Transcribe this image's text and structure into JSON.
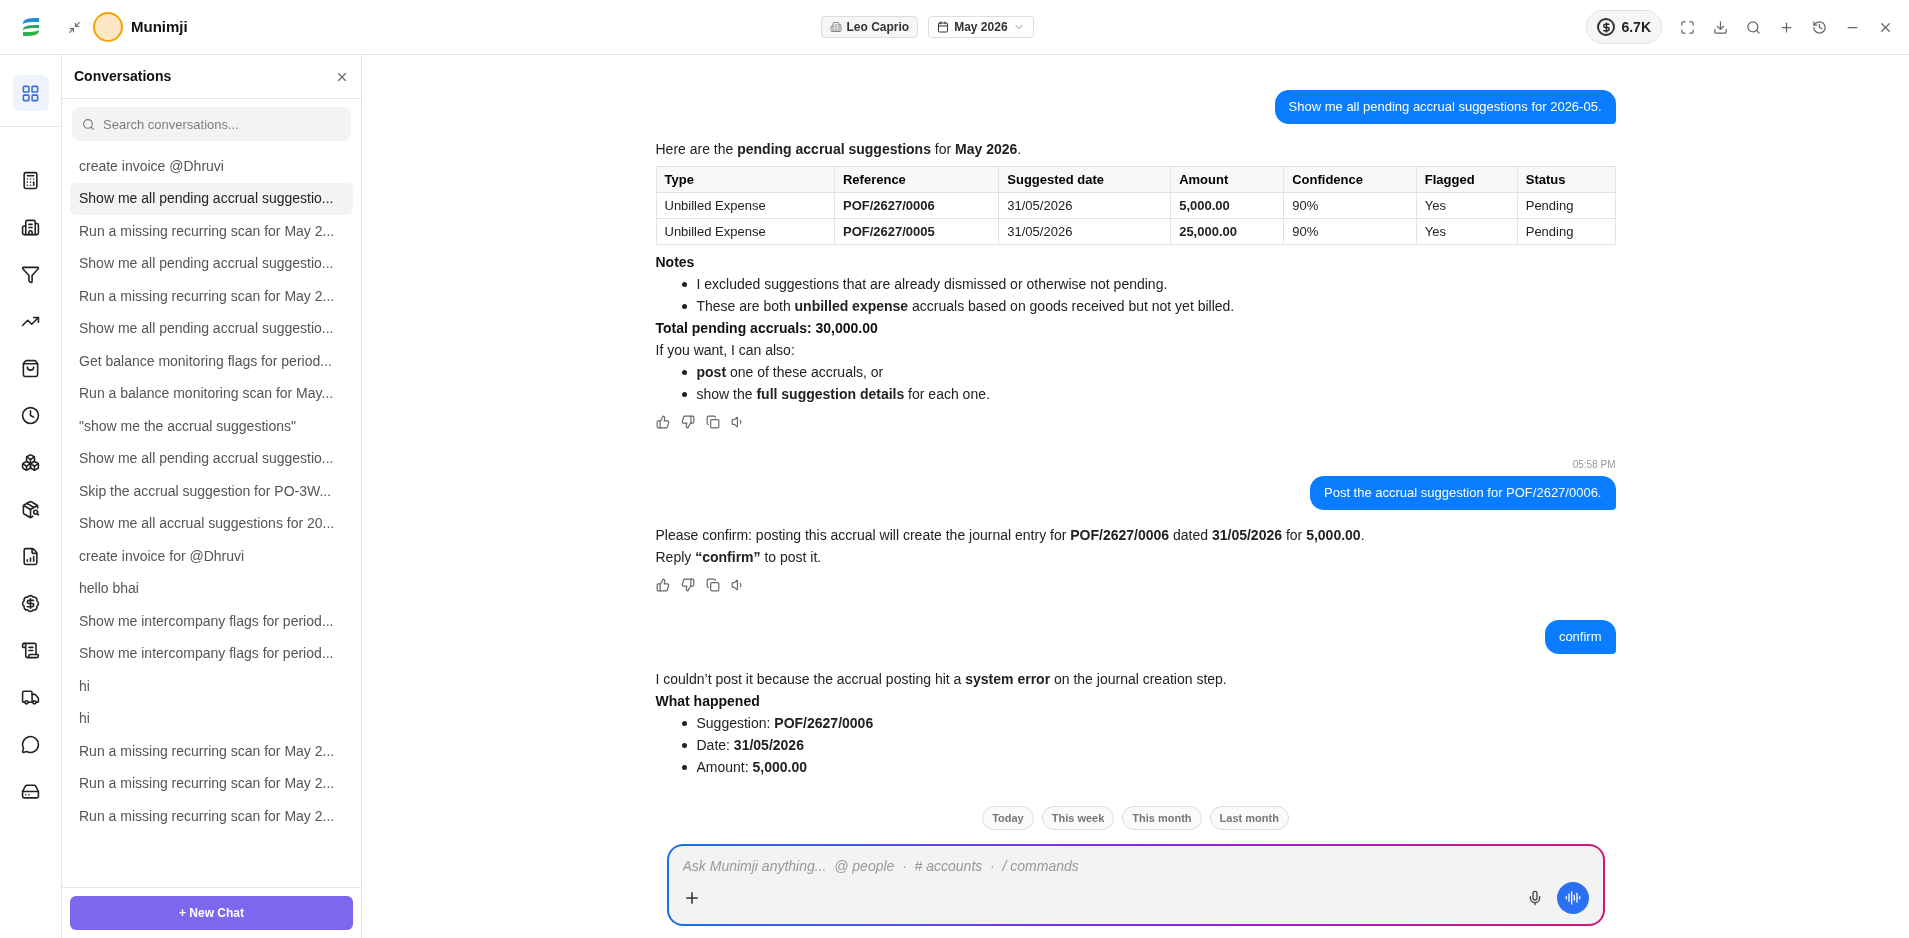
{
  "app": {
    "title": "Munimji"
  },
  "rail": [
    {
      "selected": true
    },
    {
      "selected": false
    },
    {
      "selected": false
    },
    {
      "selected": false
    },
    {
      "selected": false
    },
    {
      "selected": false
    },
    {
      "selected": false
    },
    {
      "selected": false
    },
    {
      "selected": false
    },
    {
      "selected": false
    },
    {
      "selected": false
    },
    {
      "selected": false
    },
    {
      "selected": false
    },
    {
      "selected": false
    },
    {
      "selected": false
    }
  ],
  "header": {
    "company": "Leo Caprio",
    "period": "May 2026",
    "balance": "6.7K"
  },
  "sidebar": {
    "title": "Conversations",
    "search": {
      "placeholder": "Search conversations..."
    },
    "new_chat": "+ New Chat",
    "items": [
      {
        "label": "create invoice @Dhruvi",
        "selected": false
      },
      {
        "label": "Show me all pending accrual suggestio...",
        "selected": true
      },
      {
        "label": "Run a missing recurring scan for May 2...",
        "selected": false
      },
      {
        "label": "Show me all pending accrual suggestio...",
        "selected": false
      },
      {
        "label": "Run a missing recurring scan for May 2...",
        "selected": false
      },
      {
        "label": "Show me all pending accrual suggestio...",
        "selected": false
      },
      {
        "label": "Get balance monitoring flags for period...",
        "selected": false
      },
      {
        "label": "Run a balance monitoring scan for May...",
        "selected": false
      },
      {
        "label": "\"show me the accrual suggestions\"",
        "selected": false
      },
      {
        "label": "Show me all pending accrual suggestio...",
        "selected": false
      },
      {
        "label": "Skip the accrual suggestion for PO-3W...",
        "selected": false
      },
      {
        "label": "Show me all accrual suggestions for 20...",
        "selected": false
      },
      {
        "label": "create invoice for @Dhruvi",
        "selected": false
      },
      {
        "label": "hello bhai",
        "selected": false
      },
      {
        "label": "Show me intercompany flags for period...",
        "selected": false
      },
      {
        "label": "Show me intercompany flags for period...",
        "selected": false
      },
      {
        "label": "hi",
        "selected": false
      },
      {
        "label": "hi",
        "selected": false
      },
      {
        "label": "Run a missing recurring scan for May 2...",
        "selected": false
      },
      {
        "label": "Run a missing recurring scan for May 2...",
        "selected": false
      },
      {
        "label": "Run a missing recurring scan for May 2...",
        "selected": false
      }
    ]
  },
  "messages": [
    {
      "kind": "user",
      "text": "Show me all pending accrual suggestions for 2026-05."
    },
    {
      "kind": "assistant",
      "feedback": true,
      "blocks": [
        {
          "kind": "paragraph",
          "text": "Here are the **pending accrual suggestions** for **May 2026**."
        },
        {
          "kind": "table",
          "columns": [
            "Type",
            "Reference",
            "Suggested date",
            "Amount",
            "Confidence",
            "Flagged",
            "Status"
          ],
          "rows": [
            [
              "Unbilled Expense",
              "**POF/2627/0006**",
              "31/05/2026",
              "**5,000.00**",
              "90%",
              "Yes",
              "Pending"
            ],
            [
              "Unbilled Expense",
              "**POF/2627/0005**",
              "31/05/2026",
              "**25,000.00**",
              "90%",
              "Yes",
              "Pending"
            ]
          ]
        },
        {
          "kind": "heading",
          "text": "Notes"
        },
        {
          "kind": "bullets",
          "items": [
            "I excluded suggestions that are already dismissed or otherwise not pending.",
            "These are both **unbilled expense** accruals based on goods received but not yet billed."
          ]
        },
        {
          "kind": "heading",
          "text": "Total pending accruals: 30,000.00"
        },
        {
          "kind": "paragraph",
          "text": "If you want, I can also:"
        },
        {
          "kind": "bullets",
          "items": [
            "**post** one of these accruals, or",
            "show the **full suggestion details** for each one."
          ]
        }
      ]
    },
    {
      "kind": "user",
      "time": "05:58 PM",
      "text": "Post the accrual suggestion for POF/2627/0006."
    },
    {
      "kind": "assistant",
      "feedback": true,
      "blocks": [
        {
          "kind": "paragraph",
          "text": "Please confirm: posting this accrual will create the journal entry for **POF/2627/0006** dated **31/05/2026** for **5,000.00**."
        },
        {
          "kind": "paragraph",
          "text": "Reply **“confirm”** to post it."
        }
      ]
    },
    {
      "kind": "user",
      "text": "confirm"
    },
    {
      "kind": "assistant",
      "feedback": false,
      "blocks": [
        {
          "kind": "paragraph",
          "text": "I couldn’t post it because the accrual posting hit a **system error** on the journal creation step."
        },
        {
          "kind": "heading",
          "text": "What happened"
        },
        {
          "kind": "bullets",
          "items": [
            "Suggestion: **POF/2627/0006**",
            "Date: **31/05/2026**",
            "Amount: **5,000.00**"
          ]
        }
      ]
    }
  ],
  "quick_filters": [
    "Today",
    "This week",
    "This month",
    "Last month"
  ],
  "composer": {
    "placeholder": "Ask Munimji anything...  @ people  ·  # accounts  ·  / commands"
  }
}
